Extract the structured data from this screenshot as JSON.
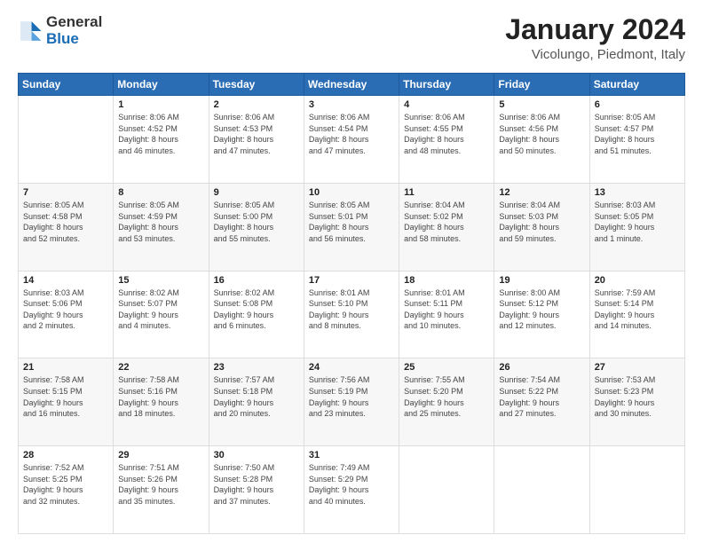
{
  "logo": {
    "general": "General",
    "blue": "Blue"
  },
  "title": "January 2024",
  "subtitle": "Vicolungo, Piedmont, Italy",
  "days_header": [
    "Sunday",
    "Monday",
    "Tuesday",
    "Wednesday",
    "Thursday",
    "Friday",
    "Saturday"
  ],
  "weeks": [
    [
      {
        "day": "",
        "info": ""
      },
      {
        "day": "1",
        "info": "Sunrise: 8:06 AM\nSunset: 4:52 PM\nDaylight: 8 hours\nand 46 minutes."
      },
      {
        "day": "2",
        "info": "Sunrise: 8:06 AM\nSunset: 4:53 PM\nDaylight: 8 hours\nand 47 minutes."
      },
      {
        "day": "3",
        "info": "Sunrise: 8:06 AM\nSunset: 4:54 PM\nDaylight: 8 hours\nand 47 minutes."
      },
      {
        "day": "4",
        "info": "Sunrise: 8:06 AM\nSunset: 4:55 PM\nDaylight: 8 hours\nand 48 minutes."
      },
      {
        "day": "5",
        "info": "Sunrise: 8:06 AM\nSunset: 4:56 PM\nDaylight: 8 hours\nand 50 minutes."
      },
      {
        "day": "6",
        "info": "Sunrise: 8:05 AM\nSunset: 4:57 PM\nDaylight: 8 hours\nand 51 minutes."
      }
    ],
    [
      {
        "day": "7",
        "info": "Sunrise: 8:05 AM\nSunset: 4:58 PM\nDaylight: 8 hours\nand 52 minutes."
      },
      {
        "day": "8",
        "info": "Sunrise: 8:05 AM\nSunset: 4:59 PM\nDaylight: 8 hours\nand 53 minutes."
      },
      {
        "day": "9",
        "info": "Sunrise: 8:05 AM\nSunset: 5:00 PM\nDaylight: 8 hours\nand 55 minutes."
      },
      {
        "day": "10",
        "info": "Sunrise: 8:05 AM\nSunset: 5:01 PM\nDaylight: 8 hours\nand 56 minutes."
      },
      {
        "day": "11",
        "info": "Sunrise: 8:04 AM\nSunset: 5:02 PM\nDaylight: 8 hours\nand 58 minutes."
      },
      {
        "day": "12",
        "info": "Sunrise: 8:04 AM\nSunset: 5:03 PM\nDaylight: 8 hours\nand 59 minutes."
      },
      {
        "day": "13",
        "info": "Sunrise: 8:03 AM\nSunset: 5:05 PM\nDaylight: 9 hours\nand 1 minute."
      }
    ],
    [
      {
        "day": "14",
        "info": "Sunrise: 8:03 AM\nSunset: 5:06 PM\nDaylight: 9 hours\nand 2 minutes."
      },
      {
        "day": "15",
        "info": "Sunrise: 8:02 AM\nSunset: 5:07 PM\nDaylight: 9 hours\nand 4 minutes."
      },
      {
        "day": "16",
        "info": "Sunrise: 8:02 AM\nSunset: 5:08 PM\nDaylight: 9 hours\nand 6 minutes."
      },
      {
        "day": "17",
        "info": "Sunrise: 8:01 AM\nSunset: 5:10 PM\nDaylight: 9 hours\nand 8 minutes."
      },
      {
        "day": "18",
        "info": "Sunrise: 8:01 AM\nSunset: 5:11 PM\nDaylight: 9 hours\nand 10 minutes."
      },
      {
        "day": "19",
        "info": "Sunrise: 8:00 AM\nSunset: 5:12 PM\nDaylight: 9 hours\nand 12 minutes."
      },
      {
        "day": "20",
        "info": "Sunrise: 7:59 AM\nSunset: 5:14 PM\nDaylight: 9 hours\nand 14 minutes."
      }
    ],
    [
      {
        "day": "21",
        "info": "Sunrise: 7:58 AM\nSunset: 5:15 PM\nDaylight: 9 hours\nand 16 minutes."
      },
      {
        "day": "22",
        "info": "Sunrise: 7:58 AM\nSunset: 5:16 PM\nDaylight: 9 hours\nand 18 minutes."
      },
      {
        "day": "23",
        "info": "Sunrise: 7:57 AM\nSunset: 5:18 PM\nDaylight: 9 hours\nand 20 minutes."
      },
      {
        "day": "24",
        "info": "Sunrise: 7:56 AM\nSunset: 5:19 PM\nDaylight: 9 hours\nand 23 minutes."
      },
      {
        "day": "25",
        "info": "Sunrise: 7:55 AM\nSunset: 5:20 PM\nDaylight: 9 hours\nand 25 minutes."
      },
      {
        "day": "26",
        "info": "Sunrise: 7:54 AM\nSunset: 5:22 PM\nDaylight: 9 hours\nand 27 minutes."
      },
      {
        "day": "27",
        "info": "Sunrise: 7:53 AM\nSunset: 5:23 PM\nDaylight: 9 hours\nand 30 minutes."
      }
    ],
    [
      {
        "day": "28",
        "info": "Sunrise: 7:52 AM\nSunset: 5:25 PM\nDaylight: 9 hours\nand 32 minutes."
      },
      {
        "day": "29",
        "info": "Sunrise: 7:51 AM\nSunset: 5:26 PM\nDaylight: 9 hours\nand 35 minutes."
      },
      {
        "day": "30",
        "info": "Sunrise: 7:50 AM\nSunset: 5:28 PM\nDaylight: 9 hours\nand 37 minutes."
      },
      {
        "day": "31",
        "info": "Sunrise: 7:49 AM\nSunset: 5:29 PM\nDaylight: 9 hours\nand 40 minutes."
      },
      {
        "day": "",
        "info": ""
      },
      {
        "day": "",
        "info": ""
      },
      {
        "day": "",
        "info": ""
      }
    ]
  ]
}
